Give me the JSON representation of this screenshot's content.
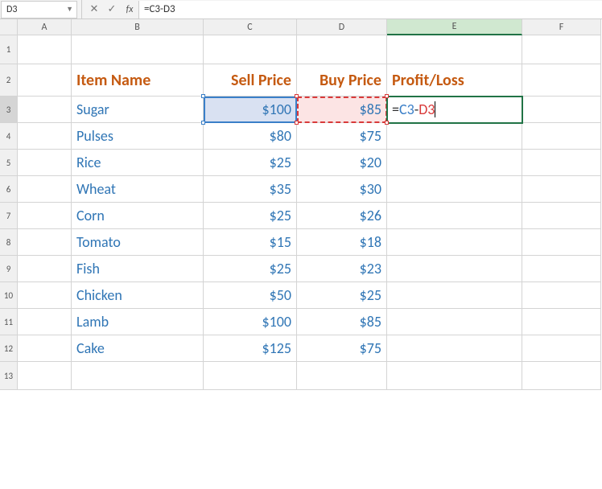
{
  "name_box": "D3",
  "formula_bar": "=C3-D3",
  "formula_parts": {
    "eq": "=",
    "ref1": "C3",
    "op": "-",
    "ref2": "D3"
  },
  "columns": [
    "A",
    "B",
    "C",
    "D",
    "E",
    "F"
  ],
  "row_nums": [
    "1",
    "2",
    "3",
    "4",
    "5",
    "6",
    "7",
    "8",
    "9",
    "10",
    "11",
    "12",
    "13"
  ],
  "headers": {
    "b": "Item Name",
    "c": "Sell Price",
    "d": "Buy Price",
    "e": "Profit/Loss"
  },
  "rows": [
    {
      "item": "Sugar",
      "sell": "$100",
      "buy": "$85"
    },
    {
      "item": "Pulses",
      "sell": "$80",
      "buy": "$75"
    },
    {
      "item": "Rice",
      "sell": "$25",
      "buy": "$20"
    },
    {
      "item": "Wheat",
      "sell": "$35",
      "buy": "$30"
    },
    {
      "item": "Corn",
      "sell": "$25",
      "buy": "$26"
    },
    {
      "item": "Tomato",
      "sell": "$15",
      "buy": "$18"
    },
    {
      "item": "Fish",
      "sell": "$25",
      "buy": "$23"
    },
    {
      "item": "Chicken",
      "sell": "$50",
      "buy": "$25"
    },
    {
      "item": "Lamb",
      "sell": "$100",
      "buy": "$85"
    },
    {
      "item": "Cake",
      "sell": "$125",
      "buy": "$75"
    }
  ],
  "chart_data": {
    "type": "table",
    "title": "",
    "columns": [
      "Item Name",
      "Sell Price",
      "Buy Price",
      "Profit/Loss"
    ],
    "rows": [
      [
        "Sugar",
        100,
        85,
        null
      ],
      [
        "Pulses",
        80,
        75,
        null
      ],
      [
        "Rice",
        25,
        20,
        null
      ],
      [
        "Wheat",
        35,
        30,
        null
      ],
      [
        "Corn",
        25,
        26,
        null
      ],
      [
        "Tomato",
        15,
        18,
        null
      ],
      [
        "Fish",
        25,
        23,
        null
      ],
      [
        "Chicken",
        50,
        25,
        null
      ],
      [
        "Lamb",
        100,
        85,
        null
      ],
      [
        "Cake",
        125,
        75,
        null
      ]
    ],
    "formula_editing": "=C3-D3"
  }
}
